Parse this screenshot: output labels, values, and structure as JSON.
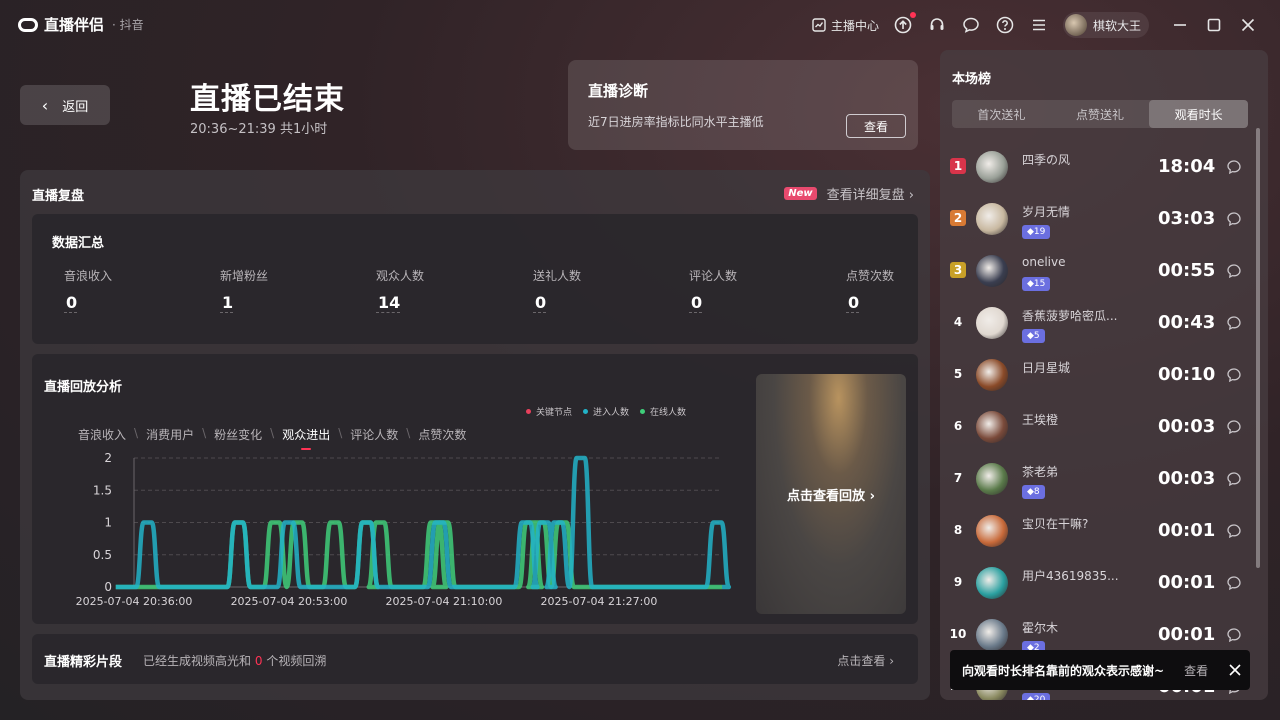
{
  "app": {
    "name": "直播伴侣",
    "sub": "· 抖音"
  },
  "titlebar": {
    "studio_label": "主播中心",
    "username": "棋软大王"
  },
  "nav": {
    "back_label": "返回"
  },
  "hero": {
    "title": "直播已结束",
    "time_range": "20:36~21:39 共1小时"
  },
  "diagnosis": {
    "title": "直播诊断",
    "desc": "近7日进房率指标比同水平主播低",
    "button": "查看"
  },
  "review": {
    "title": "直播复盘",
    "new_badge": "New",
    "detail_link": "查看详细复盘 ›"
  },
  "summary": {
    "title": "数据汇总",
    "stats": [
      {
        "label": "音浪收入",
        "value": "0"
      },
      {
        "label": "新增粉丝",
        "value": "1"
      },
      {
        "label": "观众人数",
        "value": "14"
      },
      {
        "label": "送礼人数",
        "value": "0"
      },
      {
        "label": "评论人数",
        "value": "0"
      },
      {
        "label": "点赞次数",
        "value": "0"
      }
    ]
  },
  "replay": {
    "title": "直播回放分析",
    "legend": [
      {
        "label": "关键节点",
        "color": "#e8405c"
      },
      {
        "label": "进入人数",
        "color": "#22b3c8"
      },
      {
        "label": "在线人数",
        "color": "#3fce7a"
      }
    ],
    "tabs": [
      "音浪收入",
      "消费用户",
      "粉丝变化",
      "观众进出",
      "评论人数",
      "点赞次数"
    ],
    "active_tab": 3,
    "thumb_label": "点击查看回放 ›"
  },
  "chart_data": {
    "type": "line",
    "x_ticks": [
      "2025-07-04 20:36:00",
      "2025-07-04 20:53:00",
      "2025-07-04 21:10:00",
      "2025-07-04 21:27:00"
    ],
    "y_ticks": [
      "0",
      "0.5",
      "1",
      "1.5",
      "2"
    ],
    "ylim": [
      0,
      2
    ],
    "x_range_minutes": [
      0,
      63
    ],
    "series": [
      {
        "name": "进入人数",
        "color": "#22b3c8",
        "peaks": [
          [
            1.5,
            1
          ],
          [
            11.5,
            1
          ],
          [
            17,
            1
          ],
          [
            25.5,
            1
          ],
          [
            33.5,
            1
          ],
          [
            43,
            1
          ],
          [
            45,
            1
          ],
          [
            46.5,
            1
          ],
          [
            49,
            2
          ],
          [
            64,
            1
          ]
        ]
      },
      {
        "name": "在线人数",
        "color": "#3fce7a",
        "peaks": [
          [
            11.5,
            1
          ],
          [
            15.5,
            1
          ],
          [
            18,
            1
          ],
          [
            22,
            1
          ],
          [
            25.5,
            1
          ],
          [
            27,
            1
          ],
          [
            33,
            1
          ],
          [
            34,
            1
          ],
          [
            43.5,
            1
          ],
          [
            44.5,
            1
          ],
          [
            47,
            1
          ]
        ]
      }
    ]
  },
  "clips": {
    "title": "直播精彩片段",
    "desc_prefix": "已经生成视频高光和",
    "count": "0",
    "desc_suffix": "个视频回溯",
    "link": "点击查看 ›"
  },
  "ranking": {
    "title": "本场榜",
    "tabs": [
      "首次送礼",
      "点赞送礼",
      "观看时长"
    ],
    "active_tab": 2,
    "rows": [
      {
        "rank": "1",
        "name": "四季の风",
        "badge": "",
        "time": "18:04",
        "rank_color": "#d8344a",
        "avatar": "#9aa098"
      },
      {
        "rank": "2",
        "name": "岁月无情",
        "badge": "19",
        "time": "03:03",
        "rank_color": "#d87a34",
        "avatar": "#c8b8a0"
      },
      {
        "rank": "3",
        "name": "onelive",
        "badge": "15",
        "time": "00:55",
        "rank_color": "#c8a028",
        "avatar": "#3a3e50"
      },
      {
        "rank": "4",
        "name": "香蕉菠萝哈密瓜...",
        "badge": "5",
        "time": "00:43",
        "rank_color": "",
        "avatar": "#e0d8d0"
      },
      {
        "rank": "5",
        "name": "日月星城",
        "badge": "",
        "time": "00:10",
        "rank_color": "",
        "avatar": "#8a4a28"
      },
      {
        "rank": "6",
        "name": "王埃橙",
        "badge": "",
        "time": "00:03",
        "rank_color": "",
        "avatar": "#7a4a3a"
      },
      {
        "rank": "7",
        "name": "茶老弟",
        "badge": "8",
        "time": "00:03",
        "rank_color": "",
        "avatar": "#5a7a4a"
      },
      {
        "rank": "8",
        "name": "宝贝在干嘛?",
        "badge": "",
        "time": "00:01",
        "rank_color": "",
        "avatar": "#c86a3a"
      },
      {
        "rank": "9",
        "name": "用户43619835...",
        "badge": "",
        "time": "00:01",
        "rank_color": "",
        "avatar": "#2aa0a0"
      },
      {
        "rank": "10",
        "name": "霍尔木",
        "badge": "2",
        "time": "00:01",
        "rank_color": "",
        "avatar": "#6a7a8a"
      },
      {
        "rank": "11",
        "name": "",
        "badge": "20",
        "time": "00:01",
        "rank_color": "",
        "avatar": "#8a8a60"
      }
    ]
  },
  "toast": {
    "text": "向观看时长排名靠前的观众表示感谢~",
    "link": "查看"
  }
}
